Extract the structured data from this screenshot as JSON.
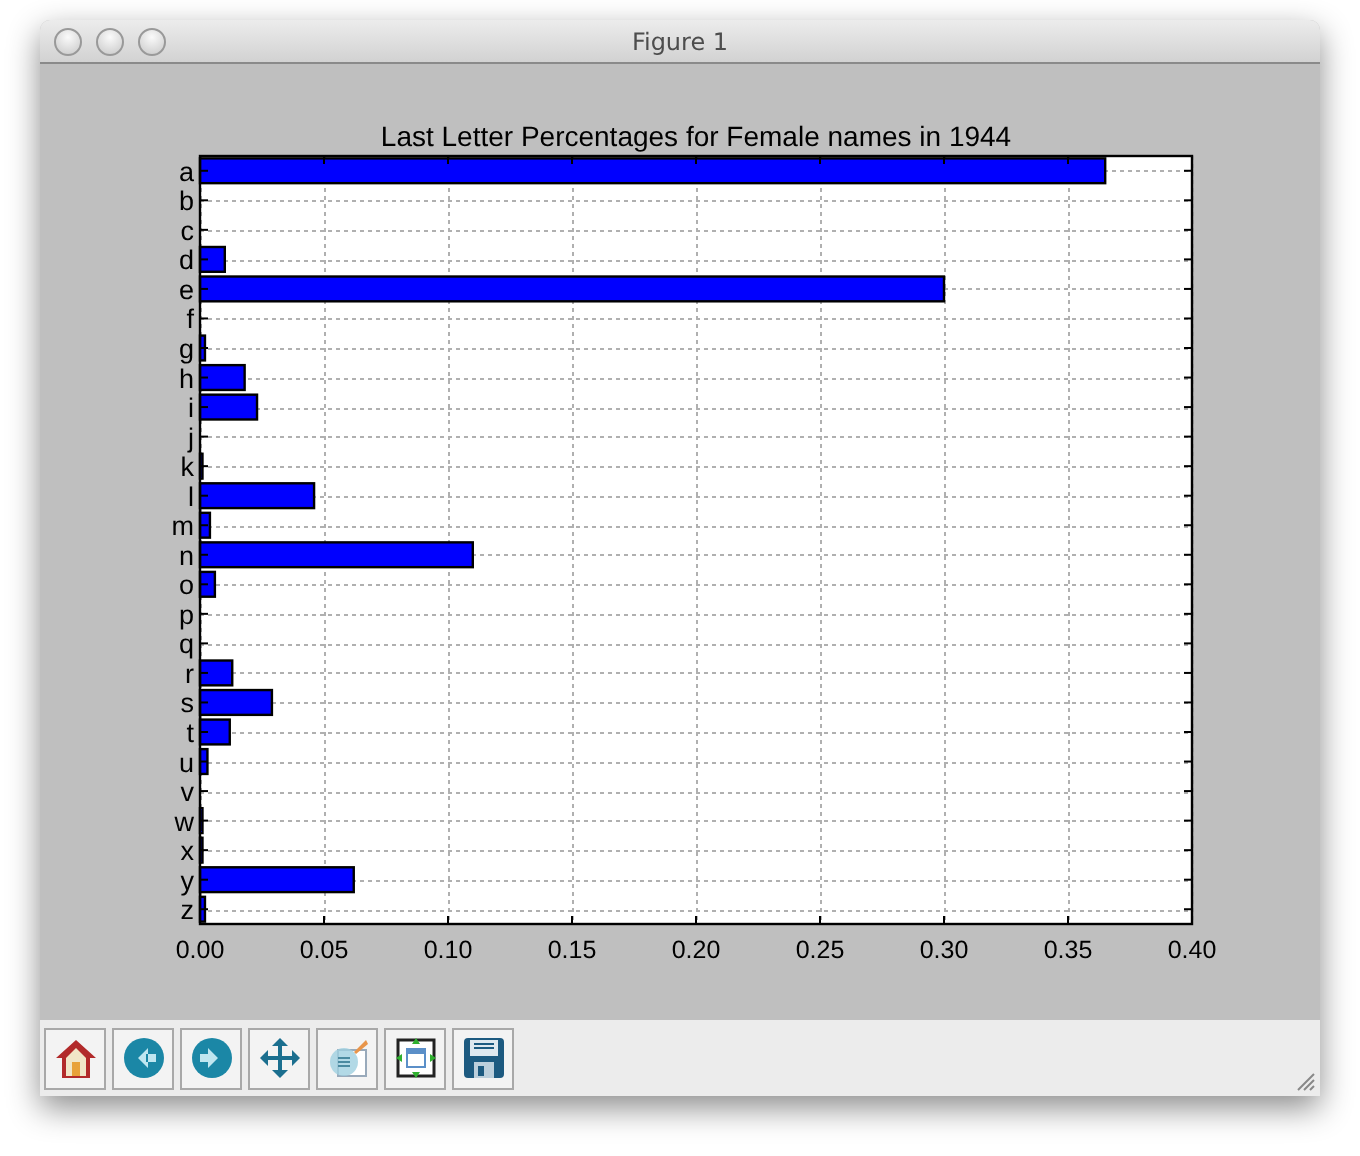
{
  "window": {
    "title": "Figure 1"
  },
  "figure": {
    "chart_data": {
      "type": "bar",
      "orientation": "horizontal",
      "title": "Last Letter Percentages for Female names in 1944",
      "categories": [
        "a",
        "b",
        "c",
        "d",
        "e",
        "f",
        "g",
        "h",
        "i",
        "j",
        "k",
        "l",
        "m",
        "n",
        "o",
        "p",
        "q",
        "r",
        "s",
        "t",
        "u",
        "v",
        "w",
        "x",
        "y",
        "z"
      ],
      "series": [
        {
          "color": "#0000ff",
          "values": [
            0.365,
            0,
            0,
            0.01,
            0.3,
            0,
            0.002,
            0.018,
            0.023,
            0,
            0.001,
            0.046,
            0.004,
            0.11,
            0.006,
            0,
            0,
            0.013,
            0.029,
            0.012,
            0.003,
            0,
            0.001,
            0.001,
            0.062,
            0.002
          ]
        }
      ],
      "xlim": [
        0,
        0.4
      ],
      "grid": true,
      "xticks": [
        {
          "value": 0,
          "label": "0.00"
        },
        {
          "value": 0.05,
          "label": "0.05"
        },
        {
          "value": 0.1,
          "label": "0.10"
        },
        {
          "value": 0.15,
          "label": "0.15"
        },
        {
          "value": 0.2,
          "label": "0.20"
        },
        {
          "value": 0.25,
          "label": "0.25"
        },
        {
          "value": 0.3,
          "label": "0.30"
        },
        {
          "value": 0.35,
          "label": "0.35"
        },
        {
          "value": 0.4,
          "label": "0.40"
        }
      ]
    }
  },
  "toolbar": [
    {
      "kind": "home"
    },
    {
      "kind": "back"
    },
    {
      "kind": "forward"
    },
    {
      "kind": "pan"
    },
    {
      "kind": "zoom"
    },
    {
      "kind": "subplots"
    },
    {
      "kind": "save"
    }
  ]
}
